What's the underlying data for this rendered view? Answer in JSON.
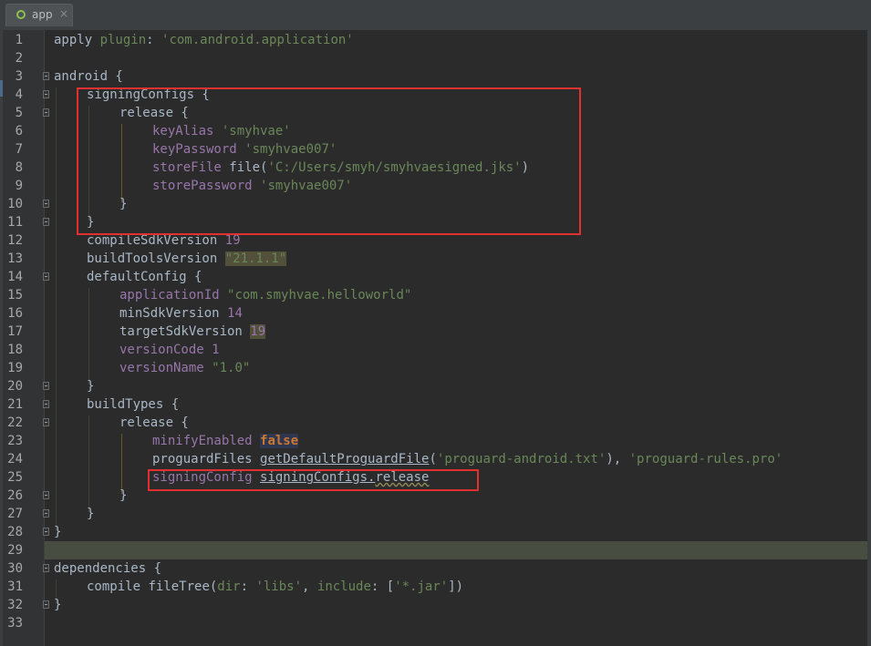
{
  "tab": {
    "label": "app",
    "close": "×"
  },
  "lines": [
    {
      "n": "1"
    },
    {
      "n": "2"
    },
    {
      "n": "3"
    },
    {
      "n": "4"
    },
    {
      "n": "5"
    },
    {
      "n": "6"
    },
    {
      "n": "7"
    },
    {
      "n": "8"
    },
    {
      "n": "9"
    },
    {
      "n": "10"
    },
    {
      "n": "11"
    },
    {
      "n": "12"
    },
    {
      "n": "13"
    },
    {
      "n": "14"
    },
    {
      "n": "15"
    },
    {
      "n": "16"
    },
    {
      "n": "17"
    },
    {
      "n": "18"
    },
    {
      "n": "19"
    },
    {
      "n": "20"
    },
    {
      "n": "21"
    },
    {
      "n": "22"
    },
    {
      "n": "23"
    },
    {
      "n": "24"
    },
    {
      "n": "25"
    },
    {
      "n": "26"
    },
    {
      "n": "27"
    },
    {
      "n": "28"
    },
    {
      "n": "29"
    },
    {
      "n": "30"
    },
    {
      "n": "31"
    },
    {
      "n": "32"
    },
    {
      "n": "33"
    }
  ],
  "code": {
    "l1": {
      "a": "apply ",
      "b": "plugin",
      "c": ": ",
      "d": "'com.android.application'"
    },
    "l3": {
      "a": "android {"
    },
    "l4": {
      "a": "signingConfigs {"
    },
    "l5": {
      "a": "release {"
    },
    "l6": {
      "a": "keyAlias ",
      "b": "'smyhvae'"
    },
    "l7": {
      "a": "keyPassword ",
      "b": "'smyhvae007'"
    },
    "l8": {
      "a": "storeFile ",
      "b": "file(",
      "c": "'C:/Users/smyh/smyhvaesigned.jks'",
      "d": ")"
    },
    "l9": {
      "a": "storePassword ",
      "b": "'smyhvae007'"
    },
    "l10": {
      "a": "}"
    },
    "l11": {
      "a": "}"
    },
    "l12": {
      "a": "compileSdkVersion ",
      "b": "19"
    },
    "l13": {
      "a": "buildToolsVersion ",
      "b": "\"21.1.1\""
    },
    "l14": {
      "a": "defaultConfig {"
    },
    "l15": {
      "a": "applicationId ",
      "b": "\"com.smyhvae.helloworld\""
    },
    "l16": {
      "a": "minSdkVersion ",
      "b": "14"
    },
    "l17": {
      "a": "targetSdkVersion ",
      "b": "19"
    },
    "l18": {
      "a": "versionCode ",
      "b": "1"
    },
    "l19": {
      "a": "versionName ",
      "b": "\"1.0\""
    },
    "l20": {
      "a": "}"
    },
    "l21": {
      "a": "buildTypes {"
    },
    "l22": {
      "a": "release {"
    },
    "l23": {
      "a": "minifyEnabled ",
      "b": "false"
    },
    "l24": {
      "a": "proguardFiles ",
      "b": "getDefaultProguardFile",
      "c": "(",
      "d": "'proguard-android.txt'",
      "e": "), ",
      "f": "'proguard-rules.pro'"
    },
    "l25": {
      "a": "signingConfig ",
      "b": "signingConfigs",
      "c": ".",
      "d": "release"
    },
    "l26": {
      "a": "}"
    },
    "l27": {
      "a": "}"
    },
    "l28": {
      "a": "}"
    },
    "l30": {
      "a": "dependencies {"
    },
    "l31": {
      "a": "compile ",
      "b": "fileTree(",
      "c": "dir",
      "d": ": ",
      "e": "'libs'",
      "f": ", ",
      "g": "include",
      "h": ": [",
      "i": "'*.jar'",
      "j": "])"
    },
    "l32": {
      "a": "}"
    }
  },
  "colors": {
    "background": "#2b2b2b",
    "keyword": "#cc7832",
    "string": "#6a8759",
    "property": "#9876aa",
    "number": "#6897bb",
    "current_line": "#474d40",
    "highlight_box": "#e03030"
  }
}
